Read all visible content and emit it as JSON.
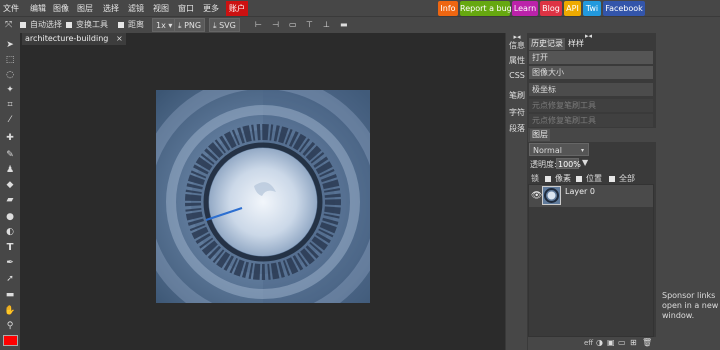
{
  "menu": {
    "items": [
      {
        "label": "文件"
      },
      {
        "label": "编辑"
      },
      {
        "label": "图像"
      },
      {
        "label": "图层"
      },
      {
        "label": "选择"
      },
      {
        "label": "滤镜"
      },
      {
        "label": "视图"
      },
      {
        "label": "窗口"
      },
      {
        "label": "更多"
      }
    ],
    "account_label": "账户"
  },
  "external_links": [
    {
      "label": "Info",
      "color": "#ee6611"
    },
    {
      "label": "Report a bug",
      "color": "#66a810"
    },
    {
      "label": "Learn",
      "color": "#bb22aa"
    },
    {
      "label": "Blog",
      "color": "#dd3344"
    },
    {
      "label": "API",
      "color": "#eeaa00"
    },
    {
      "label": "Twi",
      "color": "#2299dd"
    },
    {
      "label": "Facebook",
      "color": "#3355aa"
    }
  ],
  "toolbar": {
    "auto_select_label": "自动选择",
    "transform_label": "变换工具",
    "distance_label": "距离",
    "zoom_value": "1x",
    "export_png_label": "PNG",
    "export_svg_label": "SVG"
  },
  "document": {
    "tab_title": "architecture-building",
    "close_glyph": "×"
  },
  "side_tabs": [
    {
      "label": "信息"
    },
    {
      "label": "属性"
    },
    {
      "label": "CSS"
    },
    {
      "label": "笔刷"
    },
    {
      "label": "字符"
    },
    {
      "label": "段落"
    }
  ],
  "history_panel": {
    "tabs": [
      {
        "label": "历史记录"
      },
      {
        "label": "样样"
      }
    ],
    "rows": [
      {
        "label": "打开"
      },
      {
        "label": "图像大小"
      },
      {
        "label": "极坐标"
      },
      {
        "label": "元点修复笔刷工具"
      },
      {
        "label": "元点修复笔刷工具"
      }
    ]
  },
  "layers_panel": {
    "tab_label": "图层",
    "blend_mode": "Normal",
    "opacity_label": "透明度:",
    "opacity_value": "100%",
    "lock_label": "锁",
    "lock_options": [
      {
        "label": "像素"
      },
      {
        "label": "位置"
      },
      {
        "label": "全部"
      }
    ],
    "layer_name": "Layer 0",
    "footer_glyph": "eff"
  },
  "sponsor_text": "Sponsor links open in a new window.",
  "colors": {
    "account_bg": "#cc1111",
    "foreground_color": "#ff0000",
    "canvas_background": "#2b2b2b"
  }
}
